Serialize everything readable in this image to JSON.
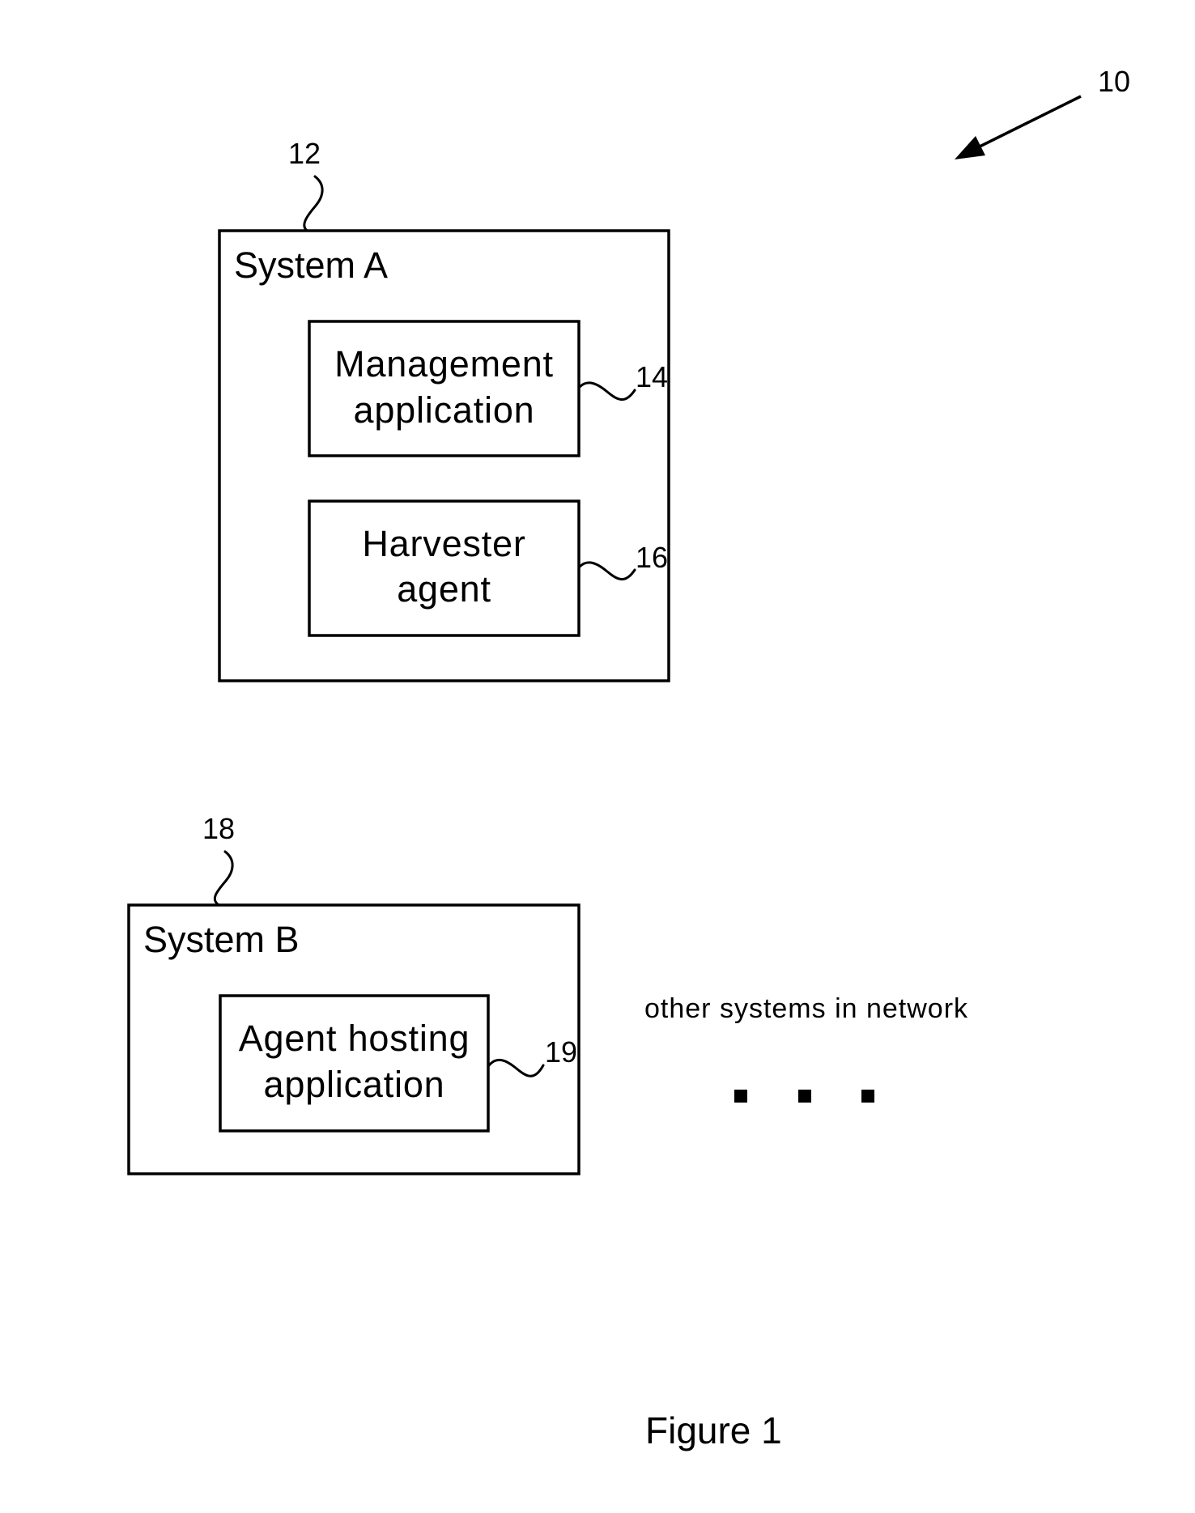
{
  "figure": {
    "caption": "Figure 1",
    "reference": "10"
  },
  "system_a": {
    "label": "System A",
    "reference": "12",
    "components": [
      {
        "lines": [
          "Management",
          "application"
        ],
        "reference": "14"
      },
      {
        "lines": [
          "Harvester",
          "agent"
        ],
        "reference": "16"
      }
    ]
  },
  "system_b": {
    "label": "System B",
    "reference": "18",
    "components": [
      {
        "lines": [
          "Agent hosting",
          "application"
        ],
        "reference": "19"
      }
    ]
  },
  "other_systems": {
    "label": "other systems in network",
    "ellipsis_count": 3
  }
}
